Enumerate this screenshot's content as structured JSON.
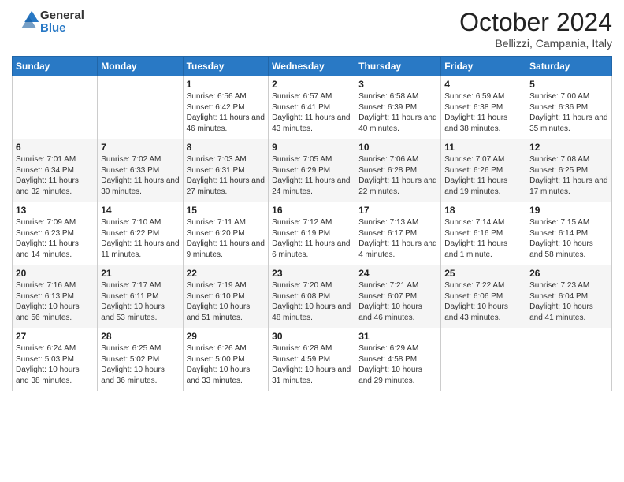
{
  "header": {
    "logo_line1": "General",
    "logo_line2": "Blue",
    "month_title": "October 2024",
    "location": "Bellizzi, Campania, Italy"
  },
  "weekdays": [
    "Sunday",
    "Monday",
    "Tuesday",
    "Wednesday",
    "Thursday",
    "Friday",
    "Saturday"
  ],
  "weeks": [
    [
      {
        "day": "",
        "sunrise": "",
        "sunset": "",
        "daylight": ""
      },
      {
        "day": "",
        "sunrise": "",
        "sunset": "",
        "daylight": ""
      },
      {
        "day": "1",
        "sunrise": "Sunrise: 6:56 AM",
        "sunset": "Sunset: 6:42 PM",
        "daylight": "Daylight: 11 hours and 46 minutes."
      },
      {
        "day": "2",
        "sunrise": "Sunrise: 6:57 AM",
        "sunset": "Sunset: 6:41 PM",
        "daylight": "Daylight: 11 hours and 43 minutes."
      },
      {
        "day": "3",
        "sunrise": "Sunrise: 6:58 AM",
        "sunset": "Sunset: 6:39 PM",
        "daylight": "Daylight: 11 hours and 40 minutes."
      },
      {
        "day": "4",
        "sunrise": "Sunrise: 6:59 AM",
        "sunset": "Sunset: 6:38 PM",
        "daylight": "Daylight: 11 hours and 38 minutes."
      },
      {
        "day": "5",
        "sunrise": "Sunrise: 7:00 AM",
        "sunset": "Sunset: 6:36 PM",
        "daylight": "Daylight: 11 hours and 35 minutes."
      }
    ],
    [
      {
        "day": "6",
        "sunrise": "Sunrise: 7:01 AM",
        "sunset": "Sunset: 6:34 PM",
        "daylight": "Daylight: 11 hours and 32 minutes."
      },
      {
        "day": "7",
        "sunrise": "Sunrise: 7:02 AM",
        "sunset": "Sunset: 6:33 PM",
        "daylight": "Daylight: 11 hours and 30 minutes."
      },
      {
        "day": "8",
        "sunrise": "Sunrise: 7:03 AM",
        "sunset": "Sunset: 6:31 PM",
        "daylight": "Daylight: 11 hours and 27 minutes."
      },
      {
        "day": "9",
        "sunrise": "Sunrise: 7:05 AM",
        "sunset": "Sunset: 6:29 PM",
        "daylight": "Daylight: 11 hours and 24 minutes."
      },
      {
        "day": "10",
        "sunrise": "Sunrise: 7:06 AM",
        "sunset": "Sunset: 6:28 PM",
        "daylight": "Daylight: 11 hours and 22 minutes."
      },
      {
        "day": "11",
        "sunrise": "Sunrise: 7:07 AM",
        "sunset": "Sunset: 6:26 PM",
        "daylight": "Daylight: 11 hours and 19 minutes."
      },
      {
        "day": "12",
        "sunrise": "Sunrise: 7:08 AM",
        "sunset": "Sunset: 6:25 PM",
        "daylight": "Daylight: 11 hours and 17 minutes."
      }
    ],
    [
      {
        "day": "13",
        "sunrise": "Sunrise: 7:09 AM",
        "sunset": "Sunset: 6:23 PM",
        "daylight": "Daylight: 11 hours and 14 minutes."
      },
      {
        "day": "14",
        "sunrise": "Sunrise: 7:10 AM",
        "sunset": "Sunset: 6:22 PM",
        "daylight": "Daylight: 11 hours and 11 minutes."
      },
      {
        "day": "15",
        "sunrise": "Sunrise: 7:11 AM",
        "sunset": "Sunset: 6:20 PM",
        "daylight": "Daylight: 11 hours and 9 minutes."
      },
      {
        "day": "16",
        "sunrise": "Sunrise: 7:12 AM",
        "sunset": "Sunset: 6:19 PM",
        "daylight": "Daylight: 11 hours and 6 minutes."
      },
      {
        "day": "17",
        "sunrise": "Sunrise: 7:13 AM",
        "sunset": "Sunset: 6:17 PM",
        "daylight": "Daylight: 11 hours and 4 minutes."
      },
      {
        "day": "18",
        "sunrise": "Sunrise: 7:14 AM",
        "sunset": "Sunset: 6:16 PM",
        "daylight": "Daylight: 11 hours and 1 minute."
      },
      {
        "day": "19",
        "sunrise": "Sunrise: 7:15 AM",
        "sunset": "Sunset: 6:14 PM",
        "daylight": "Daylight: 10 hours and 58 minutes."
      }
    ],
    [
      {
        "day": "20",
        "sunrise": "Sunrise: 7:16 AM",
        "sunset": "Sunset: 6:13 PM",
        "daylight": "Daylight: 10 hours and 56 minutes."
      },
      {
        "day": "21",
        "sunrise": "Sunrise: 7:17 AM",
        "sunset": "Sunset: 6:11 PM",
        "daylight": "Daylight: 10 hours and 53 minutes."
      },
      {
        "day": "22",
        "sunrise": "Sunrise: 7:19 AM",
        "sunset": "Sunset: 6:10 PM",
        "daylight": "Daylight: 10 hours and 51 minutes."
      },
      {
        "day": "23",
        "sunrise": "Sunrise: 7:20 AM",
        "sunset": "Sunset: 6:08 PM",
        "daylight": "Daylight: 10 hours and 48 minutes."
      },
      {
        "day": "24",
        "sunrise": "Sunrise: 7:21 AM",
        "sunset": "Sunset: 6:07 PM",
        "daylight": "Daylight: 10 hours and 46 minutes."
      },
      {
        "day": "25",
        "sunrise": "Sunrise: 7:22 AM",
        "sunset": "Sunset: 6:06 PM",
        "daylight": "Daylight: 10 hours and 43 minutes."
      },
      {
        "day": "26",
        "sunrise": "Sunrise: 7:23 AM",
        "sunset": "Sunset: 6:04 PM",
        "daylight": "Daylight: 10 hours and 41 minutes."
      }
    ],
    [
      {
        "day": "27",
        "sunrise": "Sunrise: 6:24 AM",
        "sunset": "Sunset: 5:03 PM",
        "daylight": "Daylight: 10 hours and 38 minutes."
      },
      {
        "day": "28",
        "sunrise": "Sunrise: 6:25 AM",
        "sunset": "Sunset: 5:02 PM",
        "daylight": "Daylight: 10 hours and 36 minutes."
      },
      {
        "day": "29",
        "sunrise": "Sunrise: 6:26 AM",
        "sunset": "Sunset: 5:00 PM",
        "daylight": "Daylight: 10 hours and 33 minutes."
      },
      {
        "day": "30",
        "sunrise": "Sunrise: 6:28 AM",
        "sunset": "Sunset: 4:59 PM",
        "daylight": "Daylight: 10 hours and 31 minutes."
      },
      {
        "day": "31",
        "sunrise": "Sunrise: 6:29 AM",
        "sunset": "Sunset: 4:58 PM",
        "daylight": "Daylight: 10 hours and 29 minutes."
      },
      {
        "day": "",
        "sunrise": "",
        "sunset": "",
        "daylight": ""
      },
      {
        "day": "",
        "sunrise": "",
        "sunset": "",
        "daylight": ""
      }
    ]
  ]
}
